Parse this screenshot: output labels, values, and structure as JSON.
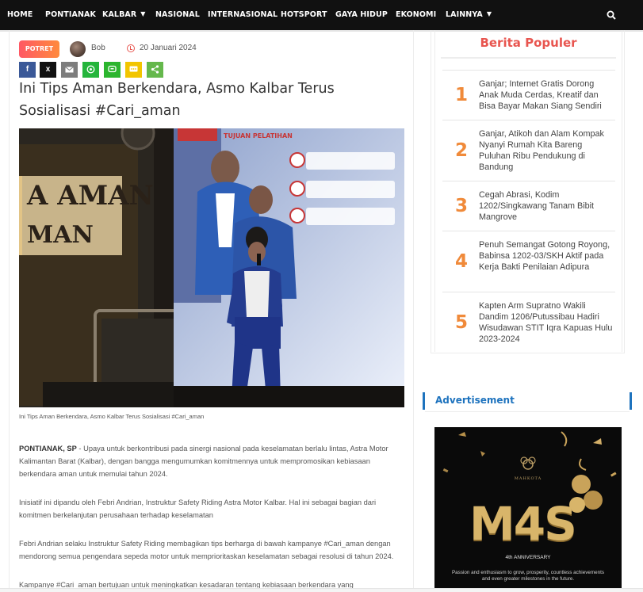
{
  "nav": {
    "items": [
      "HOME",
      "PONTIANAK",
      "KALBAR",
      "NASIONAL",
      "INTERNASIONAL",
      "HOTSPORT",
      "GAYA HIDUP",
      "EKONOMI",
      "LAINNYA"
    ],
    "search_icon": "search-icon"
  },
  "article": {
    "category": "POTRET",
    "author": "Bob",
    "date": "20 Januari 2024",
    "share": [
      "f",
      "x"
    ],
    "title": "Ini Tips Aman Berkendara, Asmo Kalbar Terus Sosialisasi #Cari_aman",
    "caption": "Ini Tips Aman Berkendara, Asmo Kalbar Terus Sosialisasi #Cari_aman",
    "slide": {
      "heading": "TUJUAN PELATIHAN",
      "banner_text": "A AMAN",
      "banner_text2": "MAN"
    },
    "p1_lead": "PONTIANAK, SP",
    "p1_body": " - Upaya untuk berkontribusi pada sinergi nasional pada keselamatan berlalu lintas, Astra Motor Kalimantan Barat (Kalbar), dengan bangga mengumumkan komitmennya untuk mempromosikan kebiasaan berkendara aman untuk memulai tahun 2024.",
    "p2": "Inisiatif ini dipandu oleh Febri Andrian, Instruktur Safety Riding Astra Motor Kalbar. Hal ini sebagai bagian dari komitmen berkelanjutan perusahaan terhadap keselamatan",
    "p3": "Febri Andrian selaku Instruktur Safety Riding membagikan tips berharga di bawah kampanye #Cari_aman dengan mendorong semua pengendara sepeda motor untuk memprioritaskan keselamatan sebagai resolusi di tahun 2024.",
    "p4": "Kampanye #Cari_aman bertujuan untuk meningkatkan kesadaran tentang kebiasaan berkendara yang"
  },
  "popular": {
    "title": "Berita Populer",
    "items": [
      {
        "num": "1",
        "text": "Ganjar; Internet Gratis Dorong Anak Muda Cerdas, Kreatif dan Bisa Bayar Makan Siang Sendiri"
      },
      {
        "num": "2",
        "text": "Ganjar, Atikoh dan Alam Kompak Nyanyi Rumah Kita Bareng Puluhan Ribu Pendukung di Bandung"
      },
      {
        "num": "3",
        "text": "Cegah Abrasi, Kodim 1202/Singkawang Tanam Bibit Mangrove"
      },
      {
        "num": "4",
        "text": "Penuh Semangat Gotong Royong, Babinsa 1202-03/SKH Aktif pada Kerja Bakti Penilaian Adipura"
      },
      {
        "num": "5",
        "text": "Kapten Arm Supratno Wakili Dandim 1206/Putussibau Hadiri Wisudawan STIT Iqra Kapuas Hulu 2023-2024"
      }
    ]
  },
  "ad": {
    "heading": "Advertisement",
    "brand": "MAHKOTA",
    "big": "M4S",
    "anniversary": "4th ANNIVERSARY",
    "tagline": "Passion and enthusiasm to grow, prosperity, countless achievements and even greater milestones in the future."
  },
  "colors": {
    "nav_bg": "#111111",
    "accent_red": "#e8554f",
    "number_orange": "#f08a3a",
    "ad_blue": "#1e73be",
    "facebook": "#3b5998",
    "x": "#111111",
    "email": "#7d7d7d",
    "whatsapp": "#25b53c",
    "line": "#2bb52e",
    "sms": "#f2c500",
    "share": "#65b84c"
  }
}
